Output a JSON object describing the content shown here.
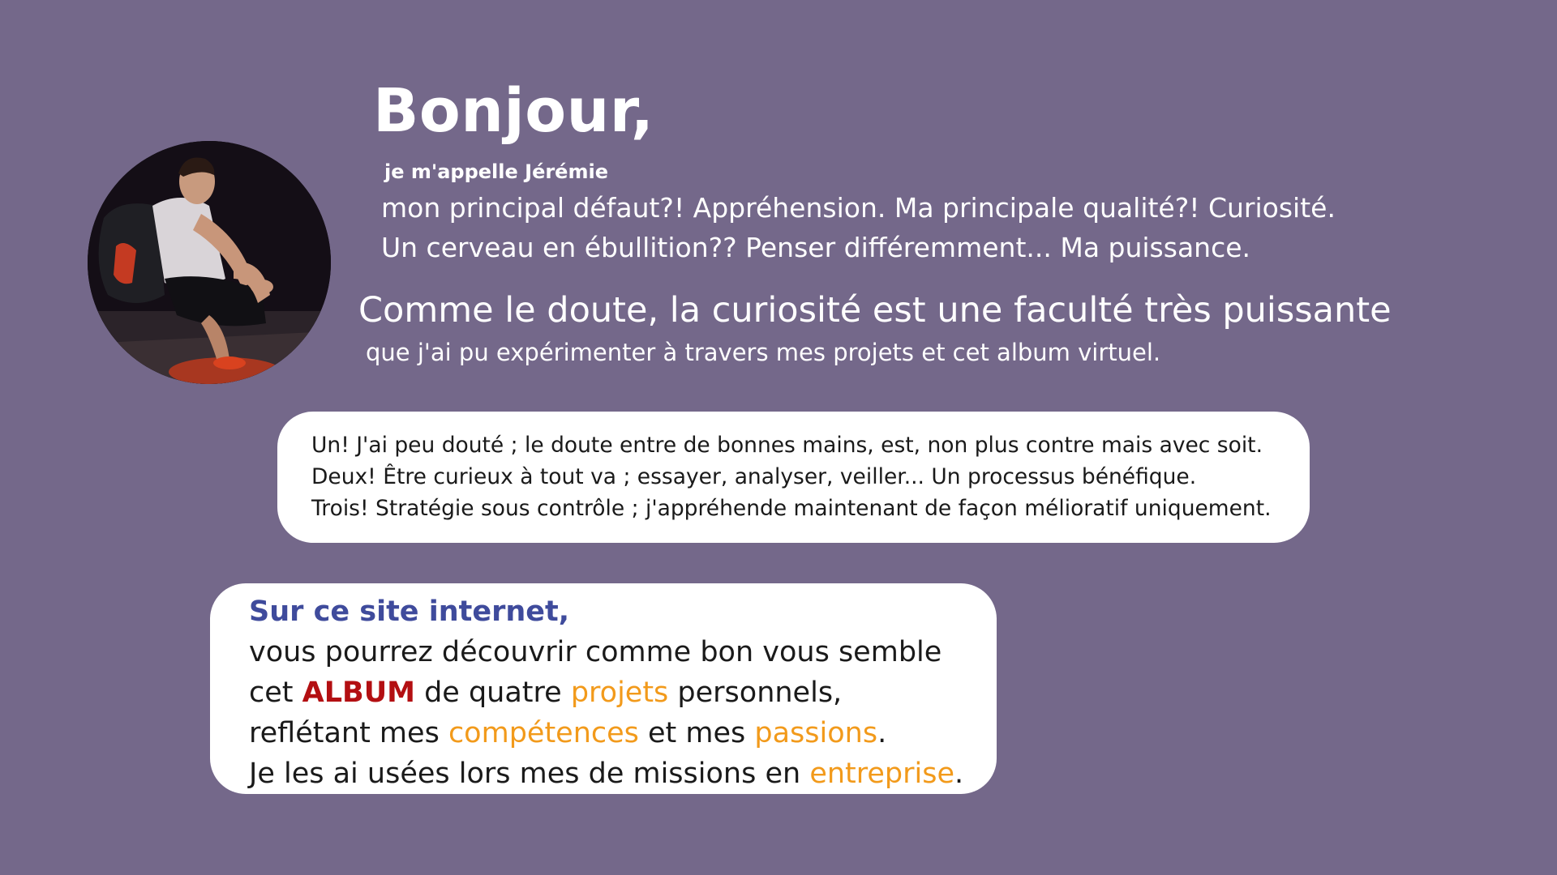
{
  "colors": {
    "background": "#74688a",
    "heading_blue": "#3f4b9c",
    "album_red": "#b30f12",
    "accent_orange": "#f29a1b"
  },
  "header": {
    "title": "Bonjour,",
    "name_line": "je m'appelle Jérémie",
    "intro_lines": [
      "mon principal défaut?! Appréhension. Ma principale qualité?! Curiosité.",
      "Un cerveau en ébullition?? Penser différemment... Ma puissance."
    ]
  },
  "quote": {
    "main": "Comme le doute, la curiosité est une faculté très puissante",
    "sub": "que j'ai pu expérimenter à travers mes projets et cet album virtuel."
  },
  "points": [
    "Un! J'ai peu douté ; le doute entre de bonnes mains, est, non plus contre mais avec soit.",
    "Deux! Être curieux à tout va ; essayer, analyser, veiller... Un processus bénéfique.",
    "Trois! Stratégie sous contrôle ; j'appréhende maintenant de façon mélioratif uniquement."
  ],
  "site": {
    "heading": "Sur ce site internet,",
    "line1": "vous pourrez découvrir comme bon vous semble",
    "line2": {
      "pre": "cet ",
      "album": "ALBUM",
      "mid": " de quatre ",
      "projets": "projets",
      "post": " personnels,"
    },
    "line3": {
      "pre": "reflétant mes ",
      "competences": "compétences",
      "mid": " et mes ",
      "passions": "passions",
      "post": "."
    },
    "line4": {
      "pre": "Je les ai usées lors mes de missions en ",
      "entreprise": "entreprise",
      "post": "."
    }
  },
  "avatar": {
    "icon": "profile-photo"
  }
}
